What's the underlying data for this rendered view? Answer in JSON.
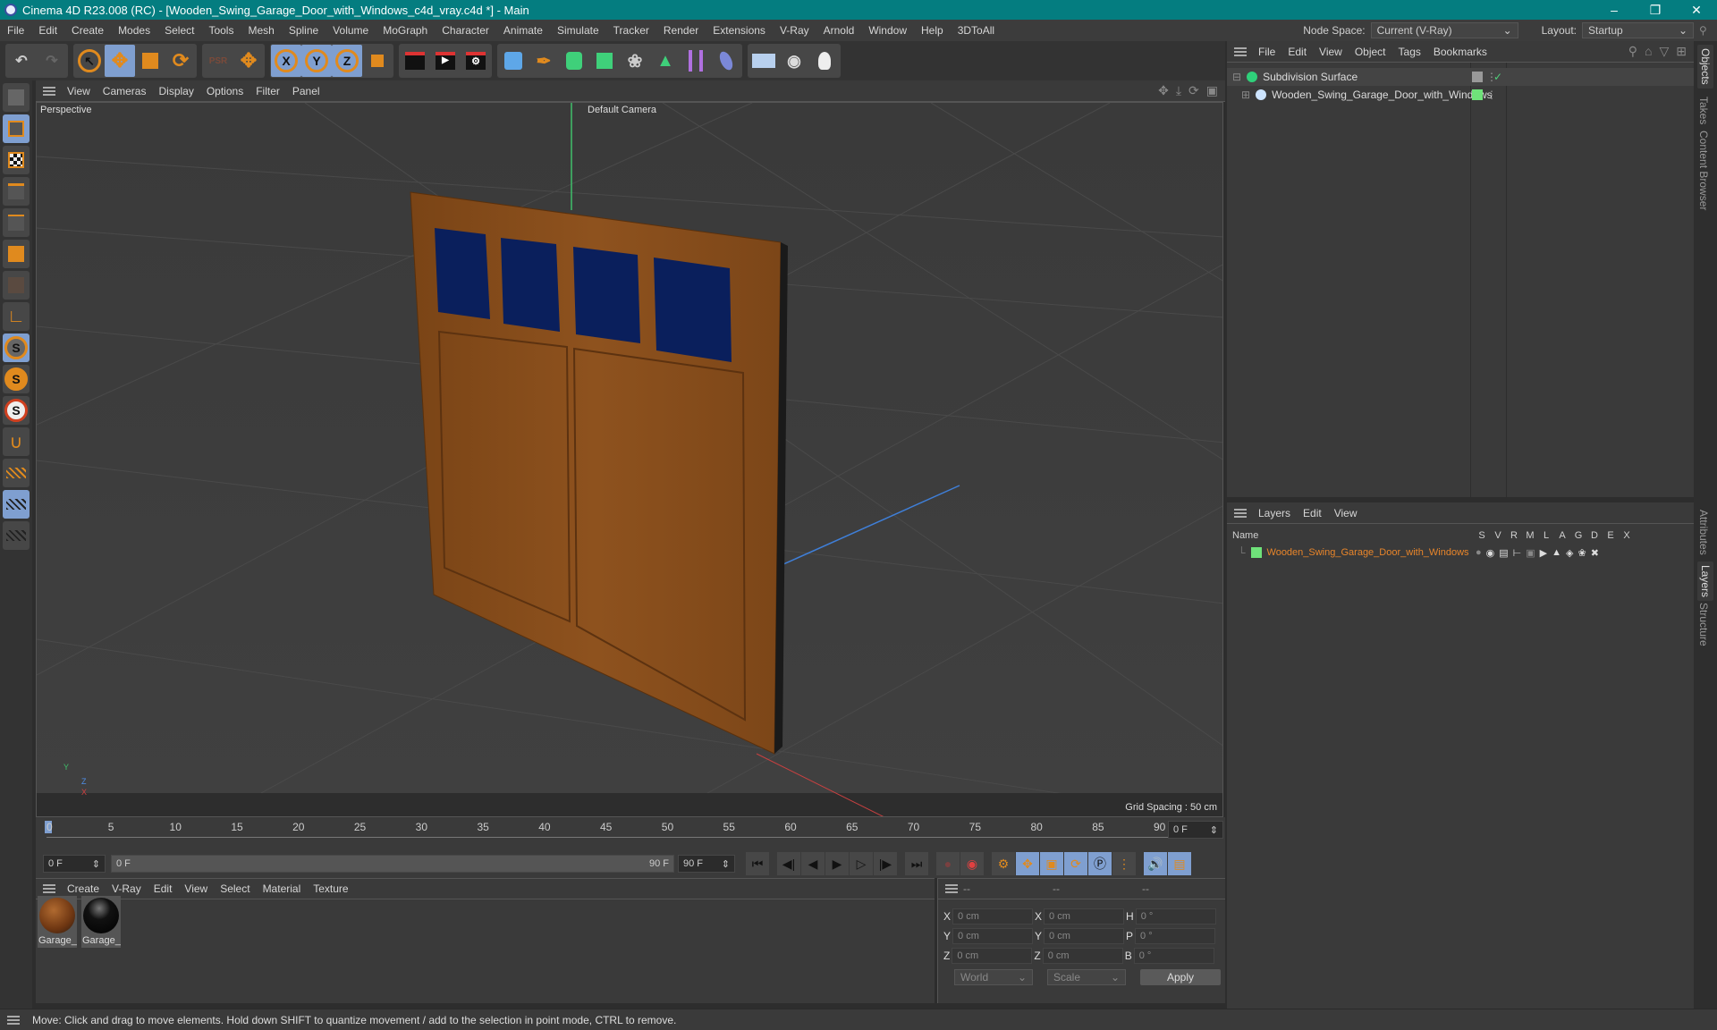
{
  "window": {
    "title": "Cinema 4D R23.008 (RC) - [Wooden_Swing_Garage_Door_with_Windows_c4d_vray.c4d *] - Main",
    "controls": [
      "minimize",
      "restore",
      "close"
    ]
  },
  "menubar": {
    "items": [
      "File",
      "Edit",
      "Create",
      "Modes",
      "Select",
      "Tools",
      "Mesh",
      "Spline",
      "Volume",
      "MoGraph",
      "Character",
      "Animate",
      "Simulate",
      "Tracker",
      "Render",
      "Extensions",
      "V-Ray",
      "Arnold",
      "Window",
      "Help",
      "3DToAll"
    ],
    "node_space_label": "Node Space:",
    "node_space_value": "Current (V-Ray)",
    "layout_label": "Layout:",
    "layout_value": "Startup"
  },
  "toolbar": {
    "groups": [
      [
        "undo-icon",
        "redo-icon"
      ],
      [
        "select-arrow-icon",
        "move-icon",
        "scale-icon",
        "rotate-icon"
      ],
      [
        "psr-icon",
        "move-axis-icon"
      ],
      [
        "x-axis-icon",
        "y-axis-icon",
        "z-axis-icon",
        "coordinate-system-icon"
      ],
      [
        "render-view-icon",
        "render-picture-viewer-icon",
        "render-settings-icon"
      ],
      [
        "cube-icon",
        "pen-icon",
        "subdivision-icon",
        "extrude-icon",
        "mograph-cloner-icon",
        "array-icon",
        "bend-icon",
        "material-icon"
      ],
      [
        "floor-icon",
        "camera-icon",
        "light-icon"
      ]
    ],
    "axis_labels": [
      "X",
      "Y",
      "Z"
    ]
  },
  "left_tools": [
    "model-mode-icon",
    "make-editable-icon",
    "texture-mode-icon",
    "points-mode-icon",
    "edges-mode-icon",
    "polygons-mode-icon",
    "uvw-mode-icon",
    "axis-mode-icon",
    "snap-icon",
    "soft-snap-icon",
    "snap-settings-icon",
    "magnet-icon",
    "workplane-icon",
    "locked-workplane-icon",
    "workplane-align-icon"
  ],
  "viewport": {
    "menu": [
      "View",
      "Cameras",
      "Display",
      "Options",
      "Filter",
      "Panel"
    ],
    "label": "Perspective",
    "camera": "Default Camera",
    "grid_spacing": "Grid Spacing : 50 cm",
    "axis": {
      "x": "X",
      "y": "Y",
      "z": "Z"
    },
    "colors": {
      "wood": "#8a4f1c",
      "glass": "#0a1f5c",
      "bg": "#3b3b3b"
    }
  },
  "timeline": {
    "ticks": [
      "0",
      "5",
      "10",
      "15",
      "20",
      "25",
      "30",
      "35",
      "40",
      "45",
      "50",
      "55",
      "60",
      "65",
      "70",
      "75",
      "80",
      "85",
      "90"
    ],
    "current_frame": "0 F",
    "start": "0 F",
    "range_start": "0 F",
    "range_end": "90 F",
    "end": "90 F"
  },
  "materials": {
    "menu": [
      "Create",
      "V-Ray",
      "Edit",
      "View",
      "Select",
      "Material",
      "Texture"
    ],
    "items": [
      {
        "label": "Garage_",
        "color": "#7a3c14"
      },
      {
        "label": "Garage_",
        "color": "#0c0c0c"
      }
    ]
  },
  "coords": {
    "headers": [
      "--",
      "--",
      "--"
    ],
    "rows": [
      {
        "a": "X",
        "av": "0 cm",
        "b": "X",
        "bv": "0 cm",
        "c": "H",
        "cv": "0 °"
      },
      {
        "a": "Y",
        "av": "0 cm",
        "b": "Y",
        "bv": "0 cm",
        "c": "P",
        "cv": "0 °"
      },
      {
        "a": "Z",
        "av": "0 cm",
        "b": "Z",
        "bv": "0 cm",
        "c": "B",
        "cv": "0 °"
      }
    ],
    "mode": "World",
    "type": "Scale",
    "apply": "Apply"
  },
  "objects": {
    "menu": [
      "File",
      "Edit",
      "View",
      "Object",
      "Tags",
      "Bookmarks"
    ],
    "items": [
      {
        "name": "Subdivision Surface",
        "indent": 0
      },
      {
        "name": "Wooden_Swing_Garage_Door_with_Windows",
        "indent": 1
      }
    ]
  },
  "layers": {
    "menu": [
      "Layers",
      "Edit",
      "View"
    ],
    "header_name": "Name",
    "columns": [
      "S",
      "V",
      "R",
      "M",
      "L",
      "A",
      "G",
      "D",
      "E",
      "X"
    ],
    "items": [
      {
        "name": "Wooden_Swing_Garage_Door_with_Windows",
        "color": "#6fe27a"
      }
    ],
    "name_color": "#e8852a"
  },
  "side_tabs": {
    "top": [
      "Objects",
      "Takes",
      "Content Browser"
    ],
    "bottom": [
      "Attributes",
      "Layers",
      "Structure"
    ]
  },
  "status": {
    "text": "Move: Click and drag to move elements. Hold down SHIFT to quantize movement / add to the selection in point mode, CTRL to remove."
  }
}
